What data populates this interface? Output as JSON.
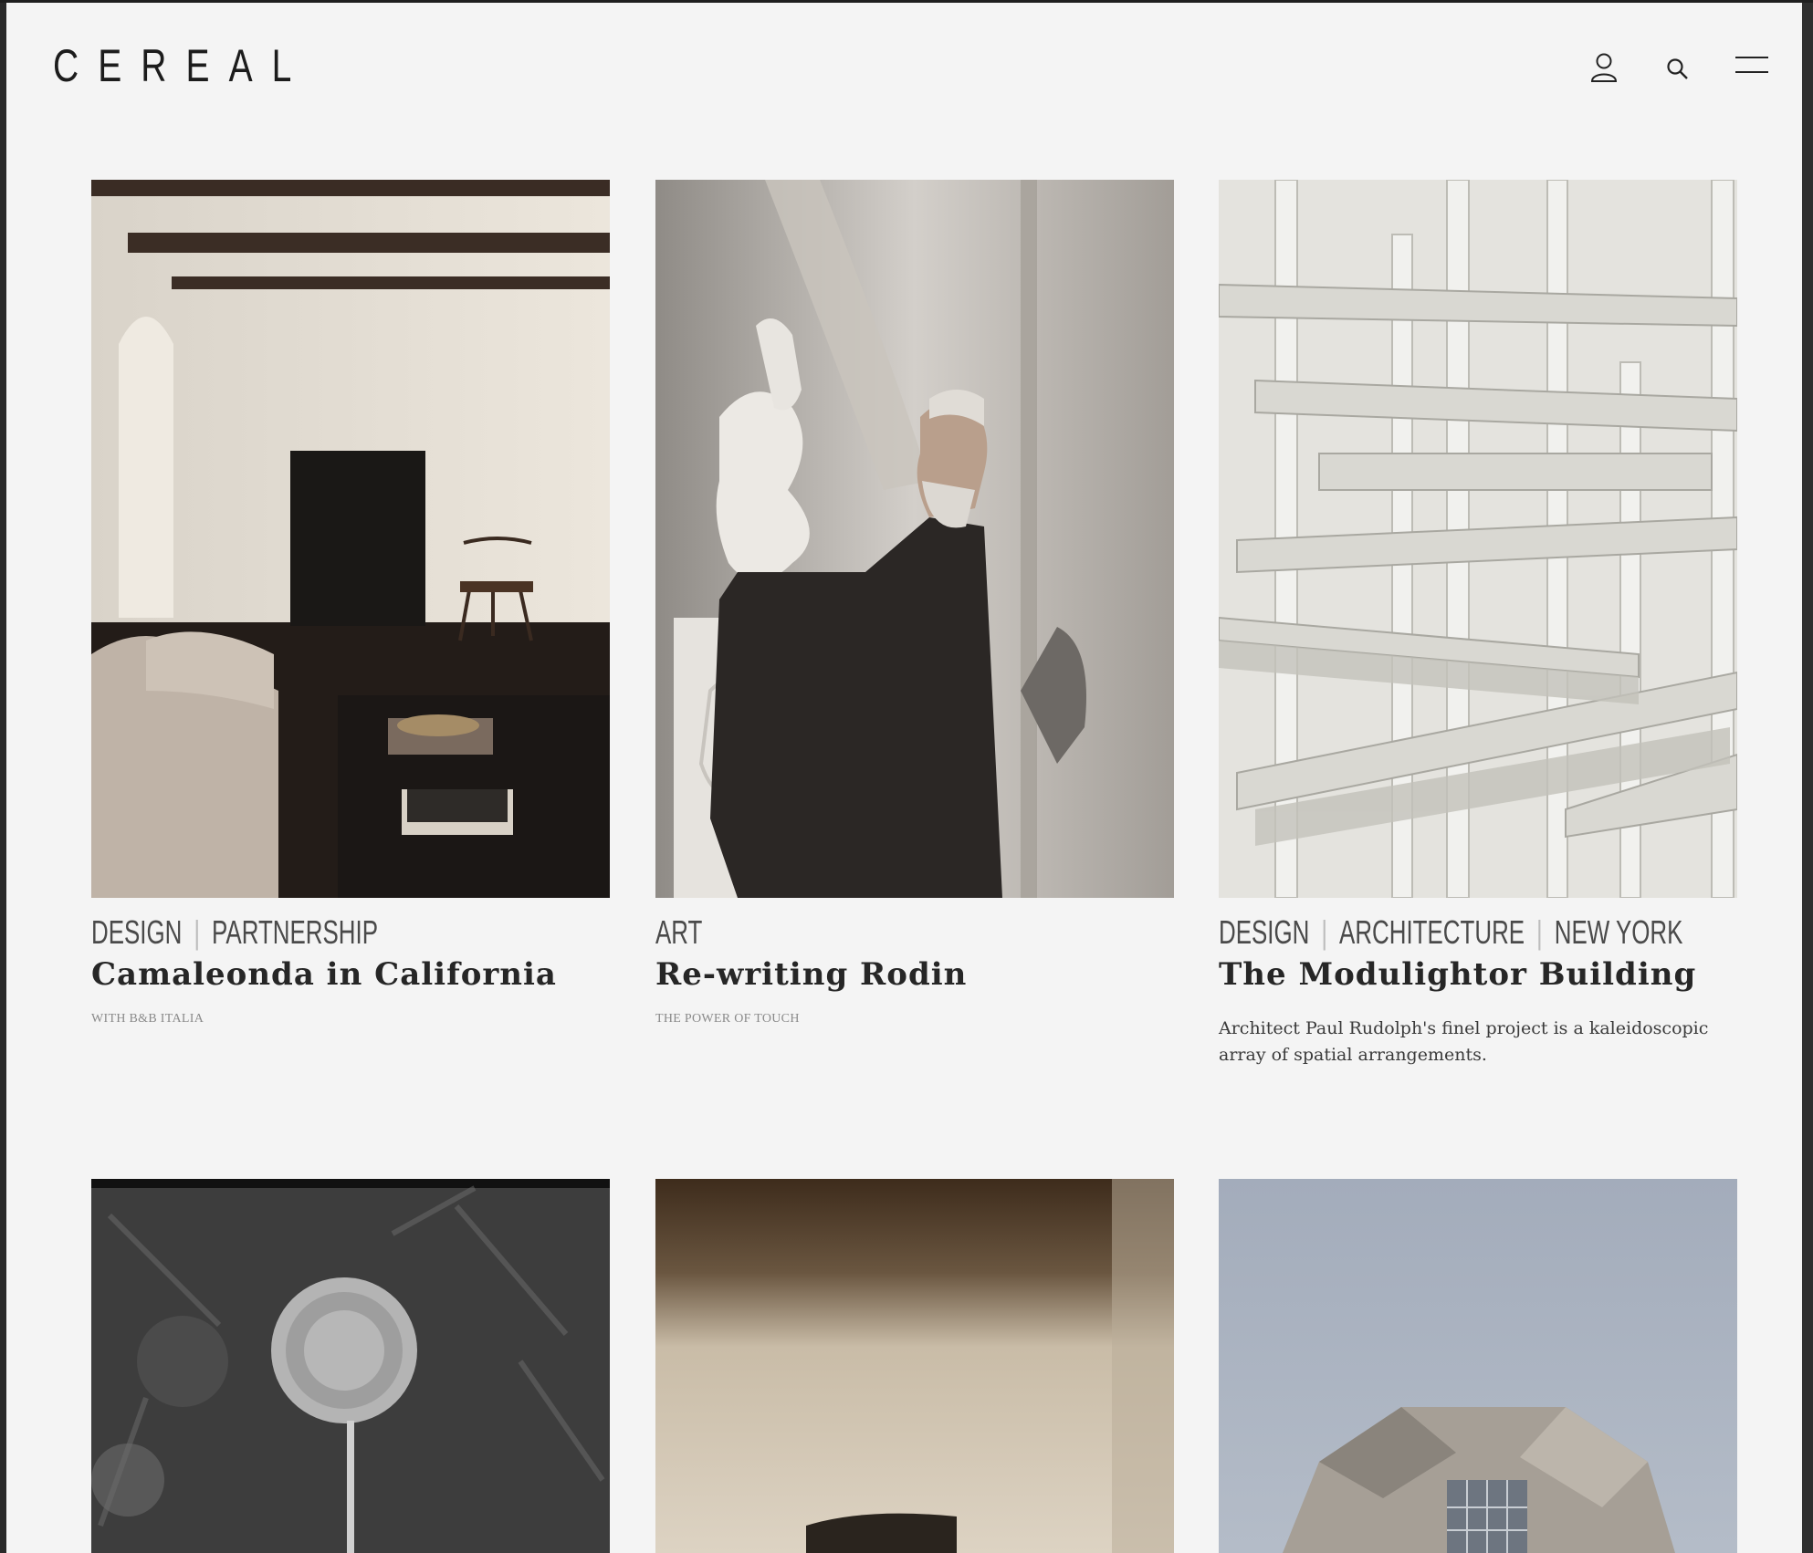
{
  "header": {
    "logo": "CEREAL",
    "icons": [
      "account-icon",
      "search-icon",
      "menu-icon"
    ]
  },
  "articles": [
    {
      "tags": [
        "DESIGN",
        "PARTNERSHIP"
      ],
      "title": "Camaleonda in California",
      "subtitle": "WITH B&B ITALIA",
      "description": ""
    },
    {
      "tags": [
        "ART"
      ],
      "title": "Re-writing Rodin",
      "subtitle": "THE POWER OF TOUCH",
      "description": ""
    },
    {
      "tags": [
        "DESIGN",
        "ARCHITECTURE",
        "NEW YORK"
      ],
      "title": "The Modulightor Building",
      "subtitle": "",
      "description": "Architect Paul Rudolph's finel project is a kaleidoscopic array of spatial arrangements."
    }
  ],
  "colors": {
    "background": "#f4f4f4",
    "text": "#262626",
    "muted": "#8a8a8a"
  }
}
